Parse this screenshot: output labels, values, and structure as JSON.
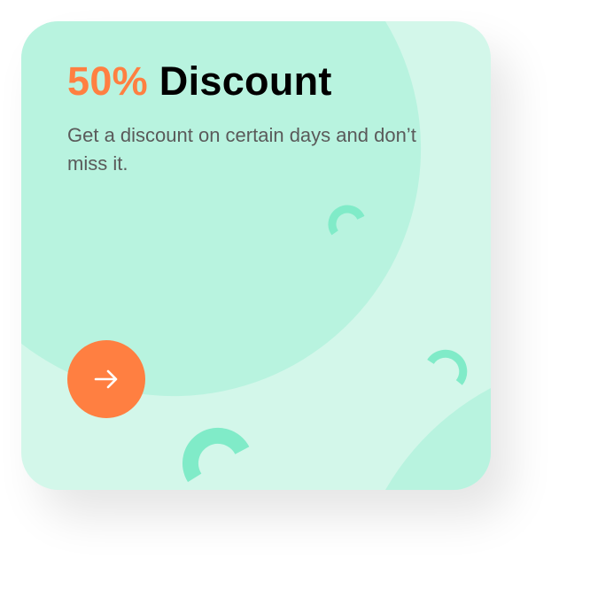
{
  "card": {
    "title_highlight": "50%",
    "title_rest": "Discount",
    "description": "Get a discount on certain days and don’t miss it.",
    "action_icon": "arrow-right-icon"
  },
  "colors": {
    "accent": "#ff7f41",
    "card_bg": "#d3f7ea",
    "blob": "#b8f3df",
    "arc": "#80ebc8"
  }
}
